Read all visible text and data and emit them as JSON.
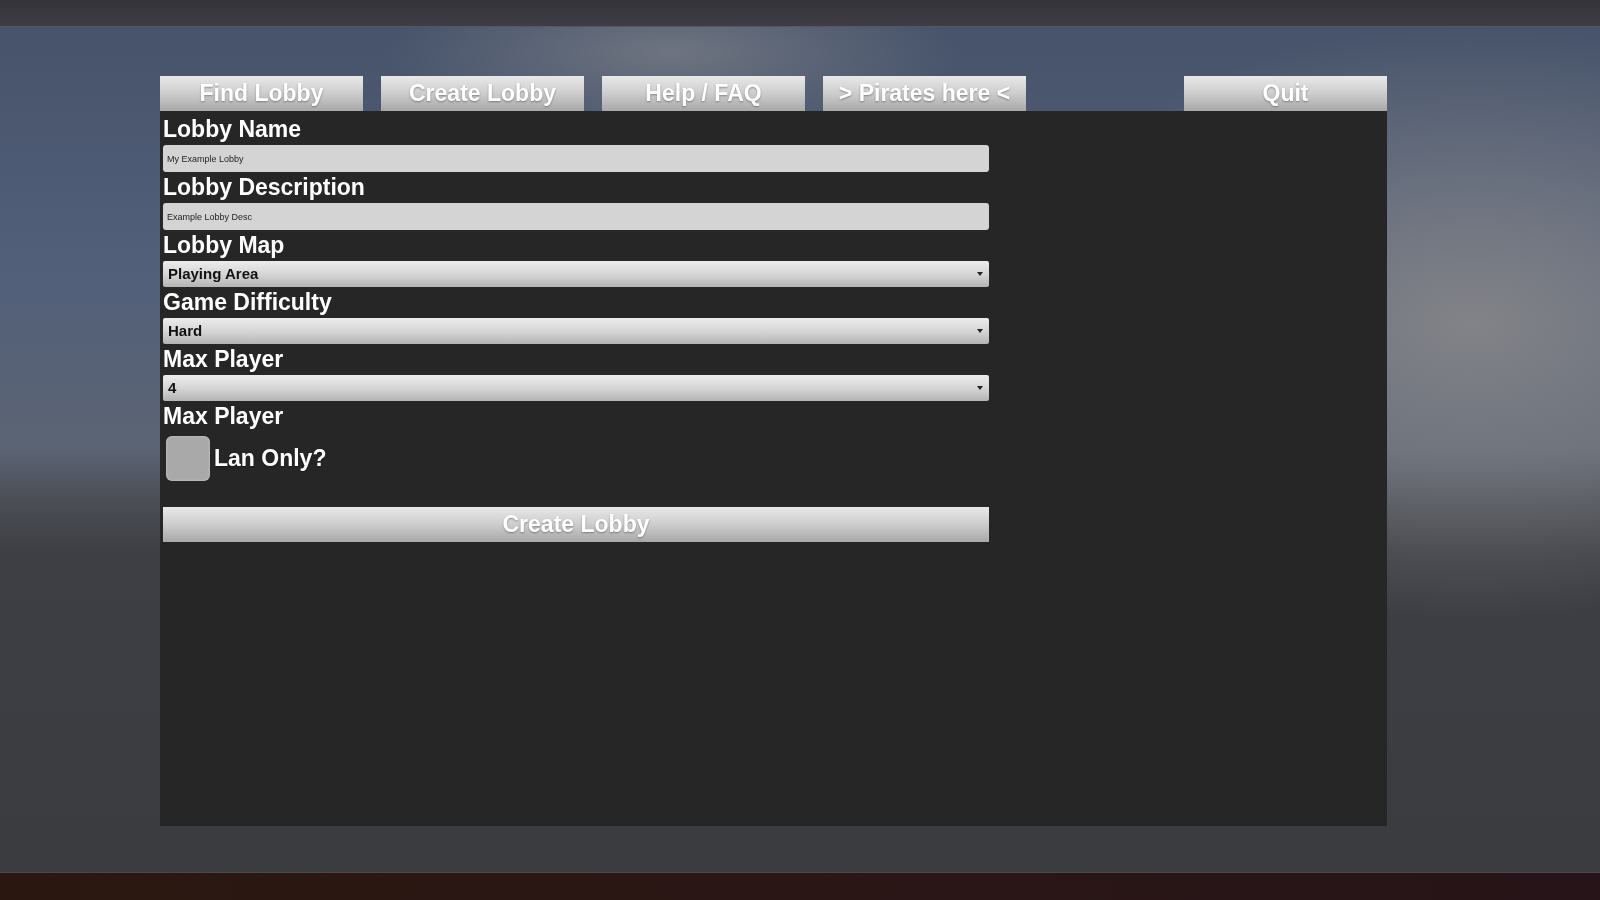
{
  "nav_buttons": [
    "Find Lobby",
    "Create Lobby",
    "Help / FAQ",
    "> Pirates here <"
  ],
  "quit_button": "Quit",
  "form": {
    "fields": [
      {
        "kind": "text",
        "label": "Lobby Name",
        "value": "My Example Lobby"
      },
      {
        "kind": "text",
        "label": "Lobby Description",
        "value": "Example Lobby Desc"
      },
      {
        "kind": "dropdown",
        "label": "Lobby Map",
        "value": "Playing Area"
      },
      {
        "kind": "dropdown",
        "label": "Game Difficulty",
        "value": "Hard"
      },
      {
        "kind": "dropdown",
        "label": "Max Player",
        "value": "4"
      },
      {
        "kind": "checkbox",
        "label": "Max Player",
        "option": "Lan Only?",
        "checked": false
      }
    ],
    "submit_button": "Create Lobby"
  }
}
